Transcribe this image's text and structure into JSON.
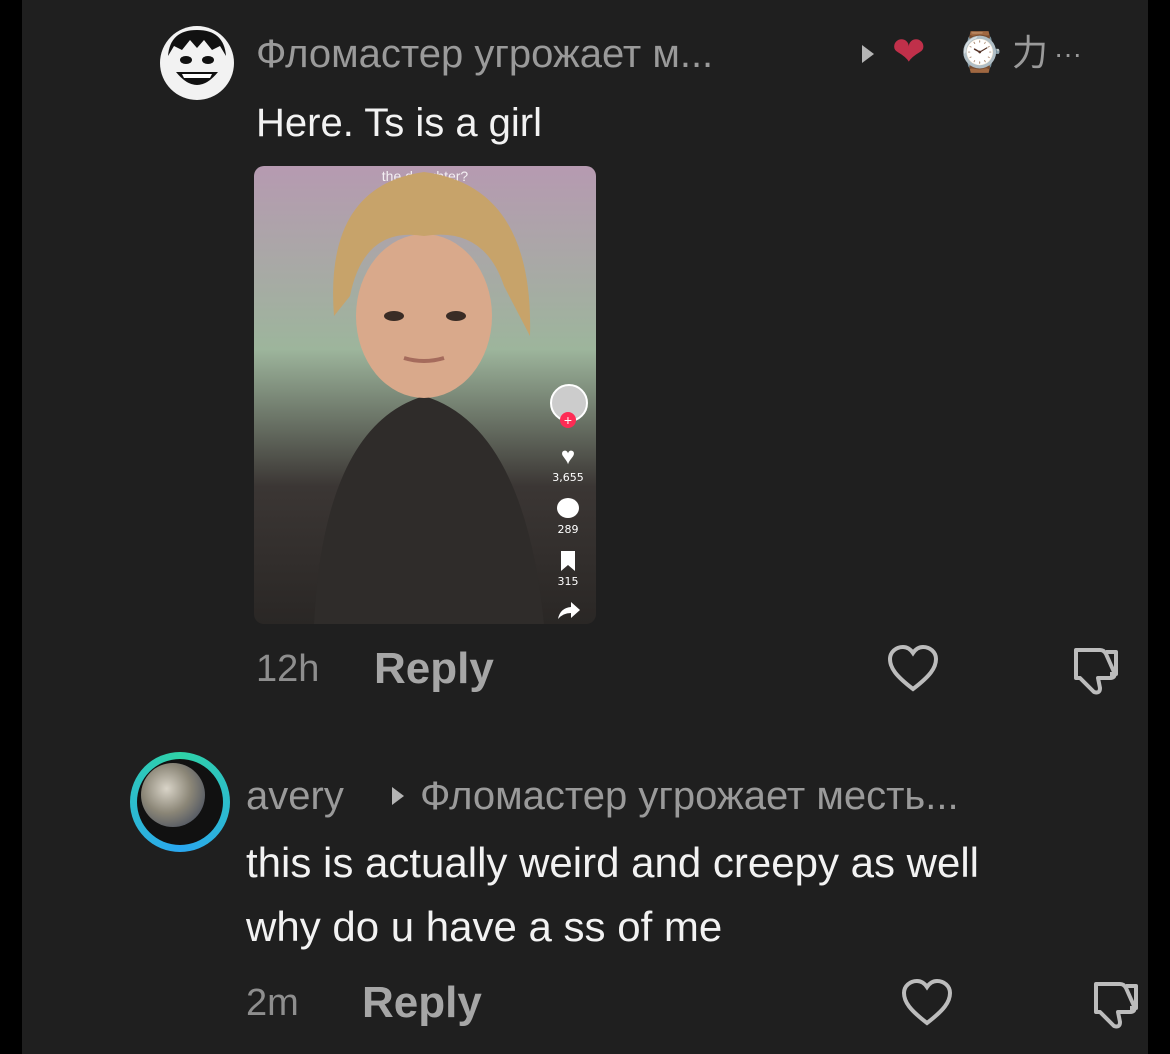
{
  "comments": [
    {
      "author": "Фломастер угрожает м...",
      "badges": [
        "❤",
        "⌚",
        "力",
        "···"
      ],
      "text": "Here. Ts is a girl",
      "attachment": {
        "top_text": "the daughter?",
        "counts": {
          "likes": "3,655",
          "comments": "289",
          "saves": "315"
        }
      },
      "time": "12h",
      "reply_label": "Reply"
    },
    {
      "author": "avery",
      "reply_to": "Фломастер угрожает месть...",
      "text_lines": [
        "this is actually weird and creepy as well",
        "why do u have a ss of me"
      ],
      "time": "2m",
      "reply_label": "Reply"
    }
  ],
  "colors": {
    "background": "#1f1f1f",
    "text": "#f2f2f2",
    "muted": "#8e8e8e",
    "ring_start": "#2fd3a7",
    "ring_end": "#2aa7f0"
  }
}
